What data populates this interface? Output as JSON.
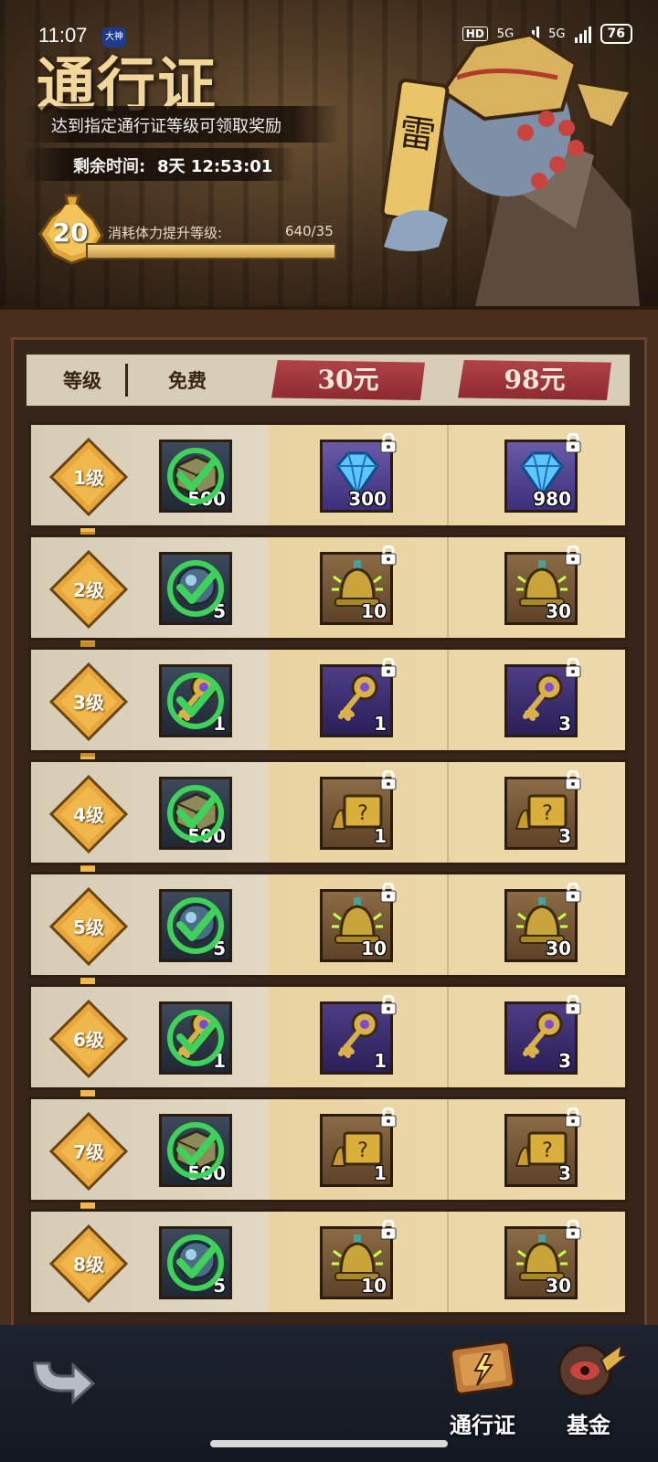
{
  "status": {
    "time": "11:07",
    "app_badge": "大神",
    "hd": "HD",
    "net1": "5G",
    "net2": "5G",
    "battery": "76"
  },
  "header": {
    "title": "通行证",
    "subtitle": "达到指定通行证等级可领取奖励",
    "time_label": "剩余时间:",
    "time_value": "8天 12:53:01",
    "level": "20",
    "exp_label": "消耗体力提升等级:",
    "exp_value": "640/35",
    "exp_progress": 1.0
  },
  "table": {
    "col_level": "等级",
    "col_free": "免费",
    "tier1": "30元",
    "tier2": "98元",
    "rows": [
      {
        "level": "1级",
        "free_icon": "supply-box-icon",
        "free_qty": "500",
        "t30_icon": "diamond-icon",
        "t30_qty": "300",
        "t98_icon": "diamond-icon",
        "t98_qty": "980"
      },
      {
        "level": "2级",
        "free_icon": "orb-icon",
        "free_qty": "5",
        "t30_icon": "bell-icon",
        "t30_qty": "10",
        "t98_icon": "bell-icon",
        "t98_qty": "30"
      },
      {
        "level": "3级",
        "free_icon": "key-icon",
        "free_qty": "1",
        "t30_icon": "key-icon",
        "t30_qty": "1",
        "t98_icon": "key-icon",
        "t98_qty": "3"
      },
      {
        "level": "4级",
        "free_icon": "supply-box-icon",
        "free_qty": "500",
        "t30_icon": "mystery-chest-icon",
        "t30_qty": "1",
        "t98_icon": "mystery-chest-icon",
        "t98_qty": "3"
      },
      {
        "level": "5级",
        "free_icon": "orb-icon",
        "free_qty": "5",
        "t30_icon": "bell-icon",
        "t30_qty": "10",
        "t98_icon": "bell-icon",
        "t98_qty": "30"
      },
      {
        "level": "6级",
        "free_icon": "key-icon",
        "free_qty": "1",
        "t30_icon": "key-icon",
        "t30_qty": "1",
        "t98_icon": "key-icon",
        "t98_qty": "3"
      },
      {
        "level": "7级",
        "free_icon": "supply-box-icon",
        "free_qty": "500",
        "t30_icon": "mystery-chest-icon",
        "t30_qty": "1",
        "t98_icon": "mystery-chest-icon",
        "t98_qty": "3"
      },
      {
        "level": "8级",
        "free_icon": "orb-icon",
        "free_qty": "5",
        "t30_icon": "bell-icon",
        "t30_qty": "10",
        "t98_icon": "bell-icon",
        "t98_qty": "30"
      }
    ]
  },
  "nav": {
    "pass_label": "通行证",
    "fund_label": "基金"
  },
  "colors": {
    "tier_red": "#a23a40",
    "gold": "#f2d79b",
    "check_green": "#3fd25a"
  }
}
